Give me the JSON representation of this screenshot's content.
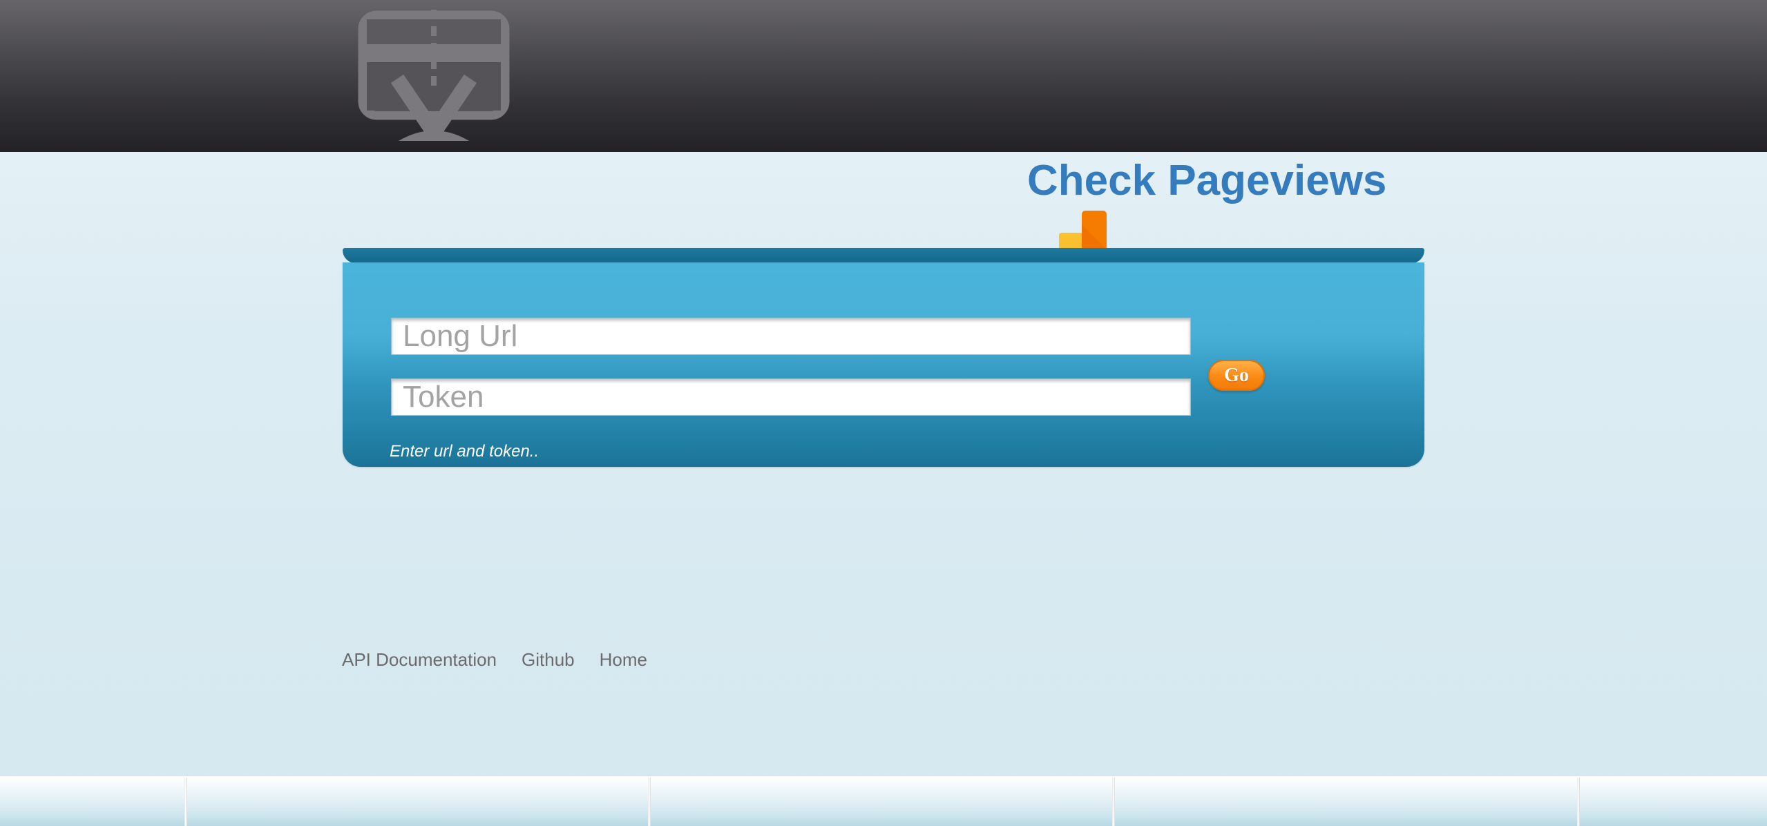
{
  "header": {
    "logo_icon": "video-download-logo-icon"
  },
  "title": {
    "text": "Check Pageviews",
    "icon": "analytics-chart-icon"
  },
  "form": {
    "url_placeholder": "Long Url",
    "url_value": "",
    "token_placeholder": "Token",
    "token_value": "",
    "go_label": "Go",
    "status_text": "Enter url and token.."
  },
  "footer": {
    "links": [
      "API Documentation",
      "Github",
      "Home"
    ]
  },
  "colors": {
    "title": "#347cbd",
    "panel": "#48b0d6",
    "go_button": "#fb8a14",
    "header": "#2f2e32"
  }
}
